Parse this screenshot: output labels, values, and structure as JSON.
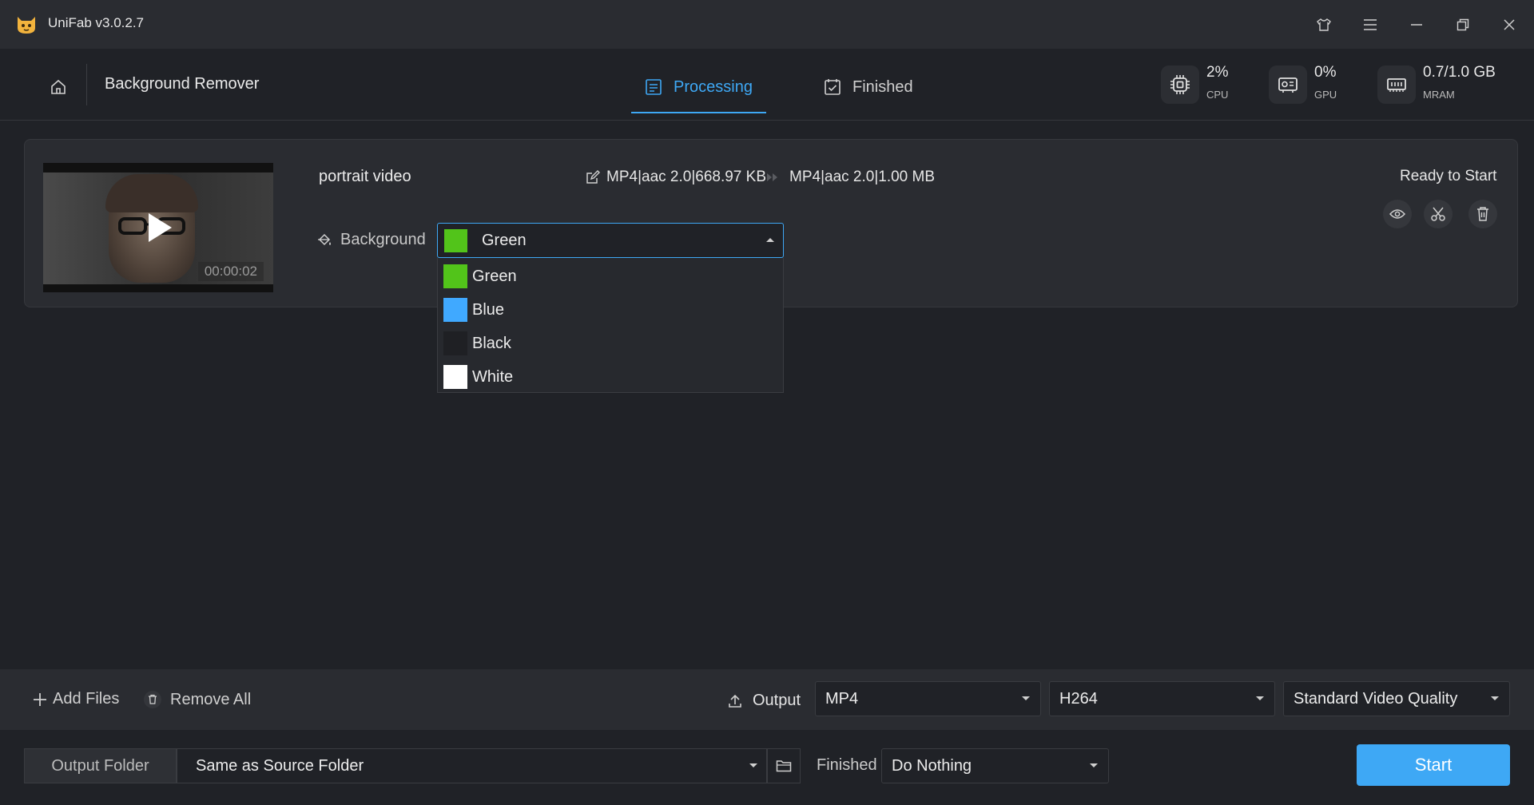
{
  "app": {
    "title": "UniFab v3.0.2.7",
    "accent_color": "#3ea8f5"
  },
  "window_controls": [
    "shirt-icon",
    "menu-icon",
    "minimize-icon",
    "restore-icon",
    "close-icon"
  ],
  "header": {
    "page_title": "Background Remover",
    "tabs": [
      {
        "label": "Processing",
        "icon": "processing-list-icon",
        "active": true
      },
      {
        "label": "Finished",
        "icon": "finished-check-icon",
        "active": false
      }
    ],
    "stats": [
      {
        "value": "2%",
        "label": "CPU",
        "icon": "cpu-icon"
      },
      {
        "value": "0%",
        "label": "GPU",
        "icon": "gpu-icon"
      },
      {
        "value": "0.7/1.0 GB",
        "label": "MRAM",
        "icon": "memory-icon"
      }
    ]
  },
  "task": {
    "file_name": "portrait video",
    "duration": "00:00:02",
    "source_info": "MP4|aac 2.0|668.97 KB",
    "target_info": "MP4|aac 2.0|1.00 MB",
    "status": "Ready to Start",
    "background": {
      "label": "Background",
      "selected": "Green",
      "selected_color": "#52c41a",
      "options": [
        {
          "label": "Green",
          "color": "#52c41a"
        },
        {
          "label": "Blue",
          "color": "#40a9ff"
        },
        {
          "label": "Black",
          "color": "#1f2024"
        },
        {
          "label": "White",
          "color": "#ffffff"
        }
      ]
    }
  },
  "toolbar": {
    "add_files": "Add Files",
    "remove_all": "Remove All",
    "output_label": "Output",
    "format": "MP4",
    "codec": "H264",
    "quality": "Standard Video Quality"
  },
  "footer": {
    "output_folder_tab": "Output Folder",
    "output_folder_value": "Same as Source Folder",
    "finished_label": "Finished",
    "finished_action": "Do Nothing",
    "start": "Start"
  }
}
